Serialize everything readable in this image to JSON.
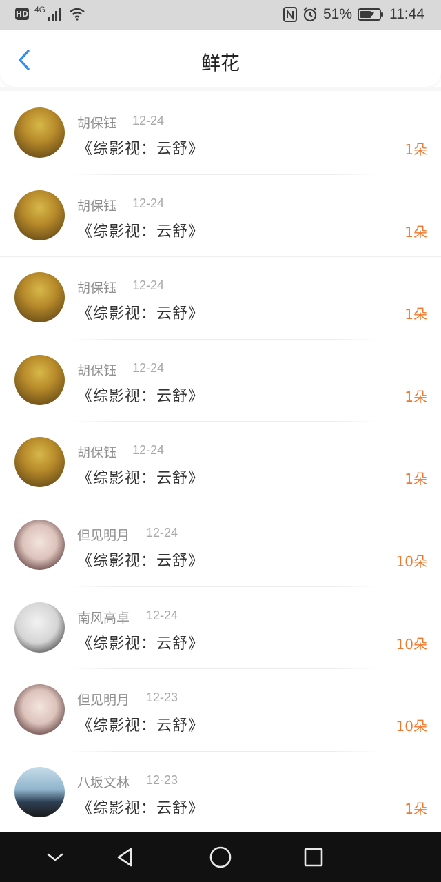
{
  "status_bar": {
    "hd": "HD",
    "network": "4G",
    "battery": "51%",
    "time": "11:44"
  },
  "header": {
    "title": "鲜花",
    "back_icon": "chevron-left-icon"
  },
  "rows": [
    {
      "name": "胡保钰",
      "date": "12-24",
      "book": "《综影视：云舒》",
      "amount": "1朵",
      "avatar": "forest"
    },
    {
      "name": "胡保钰",
      "date": "12-24",
      "book": "《综影视：云舒》",
      "amount": "1朵",
      "avatar": "forest"
    },
    {
      "name": "胡保钰",
      "date": "12-24",
      "book": "《综影视：云舒》",
      "amount": "1朵",
      "avatar": "forest"
    },
    {
      "name": "胡保钰",
      "date": "12-24",
      "book": "《综影视：云舒》",
      "amount": "1朵",
      "avatar": "forest"
    },
    {
      "name": "胡保钰",
      "date": "12-24",
      "book": "《综影视：云舒》",
      "amount": "1朵",
      "avatar": "forest"
    },
    {
      "name": "但见明月",
      "date": "12-24",
      "book": "《综影视：云舒》",
      "amount": "10朵",
      "avatar": "girl1"
    },
    {
      "name": "南风高卓",
      "date": "12-24",
      "book": "《综影视：云舒》",
      "amount": "10朵",
      "avatar": "girl2"
    },
    {
      "name": "但见明月",
      "date": "12-23",
      "book": "《综影视：云舒》",
      "amount": "10朵",
      "avatar": "girl1"
    },
    {
      "name": "八坂文林",
      "date": "12-23",
      "book": "《综影视：云舒》",
      "amount": "1朵",
      "avatar": "sea"
    }
  ],
  "colors": {
    "accent_blue": "#2f8cf0",
    "amount_orange": "#f0782e",
    "status_bar_bg": "#d9d9d9",
    "nav_bar_bg": "#111111"
  },
  "nav_bar": {
    "icons": [
      "chevron-down-icon",
      "back-triangle-icon",
      "home-circle-icon",
      "recents-square-icon"
    ]
  }
}
